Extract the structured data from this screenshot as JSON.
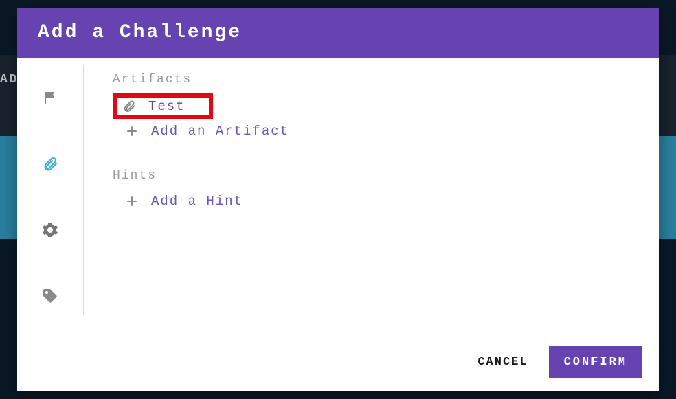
{
  "modal": {
    "title": "Add a Challenge"
  },
  "bg": {
    "left_fragment": "AD"
  },
  "tabs": {
    "flag": "flag",
    "attachment": "attachment",
    "settings": "settings",
    "tag": "tag",
    "active": "attachment"
  },
  "artifacts": {
    "label": "Artifacts",
    "items": [
      {
        "name": "Test",
        "highlighted": true
      }
    ],
    "add_label": "Add an Artifact"
  },
  "hints": {
    "label": "Hints",
    "add_label": "Add a Hint"
  },
  "footer": {
    "cancel": "CANCEL",
    "confirm": "CONFIRM"
  }
}
